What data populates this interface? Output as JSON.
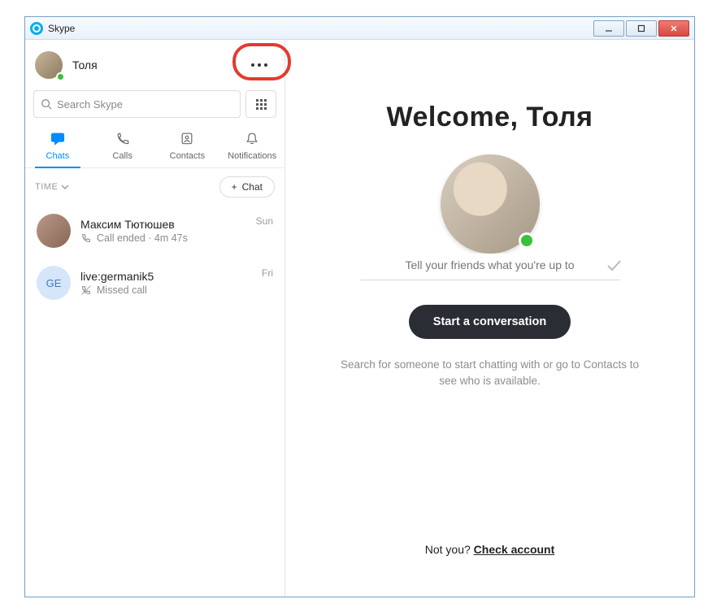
{
  "window": {
    "title": "Skype"
  },
  "sidebar": {
    "profile": {
      "name": "Толя"
    },
    "search": {
      "placeholder": "Search Skype"
    },
    "tabs": [
      {
        "label": "Chats"
      },
      {
        "label": "Calls"
      },
      {
        "label": "Contacts"
      },
      {
        "label": "Notifications"
      }
    ],
    "filter": {
      "label": "TIME"
    },
    "new_chat_label": "Chat",
    "conversations": [
      {
        "name": "Максим Тютюшев",
        "subtitle": "Call ended · 4m 47s",
        "time": "Sun",
        "avatar_text": "",
        "call_kind": "ended"
      },
      {
        "name": "live:germanik5",
        "subtitle": "Missed call",
        "time": "Fri",
        "avatar_text": "GE",
        "call_kind": "missed"
      }
    ]
  },
  "main": {
    "welcome": "Welcome, Толя",
    "status_placeholder": "Tell your friends what you're up to",
    "cta": "Start a conversation",
    "hint": "Search for someone to start chatting with or go to Contacts to see who is available.",
    "not_you_prefix": "Not you? ",
    "not_you_link": "Check account"
  }
}
